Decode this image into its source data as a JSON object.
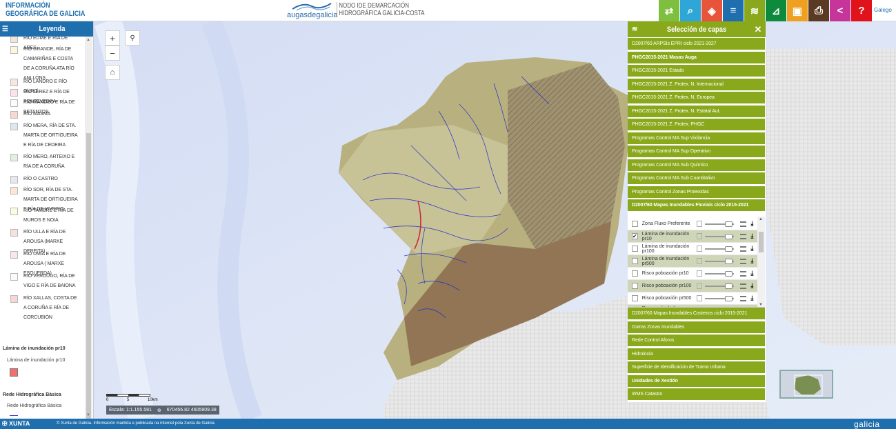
{
  "header": {
    "brand_line1": "INFORMACIÓN",
    "brand_line2": "GEOGRÁFICA DE GALICIA",
    "logo_text": "augasdegalicia",
    "node_line1": "NODO IDE DEMARCACIÓN",
    "node_line2": "HIDROGRÁFICA GALICIA-COSTA",
    "language": "Galego",
    "tools": [
      {
        "icon": "link-icon",
        "glyph": "⇄",
        "color": "#7fbf3f"
      },
      {
        "icon": "search-icon",
        "glyph": "⌕",
        "color": "#2fa6d8"
      },
      {
        "icon": "map-tool-icon",
        "glyph": "◈",
        "color": "#e8543a"
      },
      {
        "icon": "list-icon",
        "glyph": "≡",
        "color": "#1f6fae"
      },
      {
        "icon": "layers-icon",
        "glyph": "≋",
        "color": "#8aa81b"
      },
      {
        "icon": "measure-icon",
        "glyph": "⊿",
        "color": "#0e8a3c"
      },
      {
        "icon": "save-icon",
        "glyph": "▣",
        "color": "#f0a020"
      },
      {
        "icon": "print-icon",
        "glyph": "⎙",
        "color": "#5a3a22"
      },
      {
        "icon": "share-icon",
        "glyph": "<",
        "color": "#c7359a"
      },
      {
        "icon": "help-icon",
        "glyph": "?",
        "color": "#e0131b"
      }
    ]
  },
  "legend": {
    "title": "Leyenda",
    "items": [
      {
        "label": "RÍO EUME E RÍA DE ARES",
        "color": "#f3e3d8"
      },
      {
        "label": "RÍO GRANDE, RÍA DE CAMARIÑAS E COSTA DE A CORUÑA ATA RÍO ANLLÓNS",
        "color": "#fbf7d9"
      },
      {
        "label": "RÍO LANDRO E RÍO OURO",
        "color": "#f6e8e0"
      },
      {
        "label": "RÍO LÉREZ E RÍA DE PONTEVEDRA",
        "color": "#fbe3e8"
      },
      {
        "label": "RÍO MANDEO E RÍA DE BETANZOS",
        "color": "#fbfbfb"
      },
      {
        "label": "RÍO MASMA",
        "color": "#f7d9d2"
      },
      {
        "label": "RÍO MERA, RÍA DE STA. MARTA DE ORTIGUEIRA E RÍA DE CEDEIRA",
        "color": "#dee7f0"
      },
      {
        "label": "RÍO MERO, ARTEIXO E RÍA DE A CORUÑA",
        "color": "#e2f1de"
      },
      {
        "label": "RÍO O CASTRO",
        "color": "#e8e8ee"
      },
      {
        "label": "RÍO SOR, RÍA DE STA. MARTA DE ORTIGUEIRA E RÍA DE VIVEIRO",
        "color": "#fbe7d2"
      },
      {
        "label": "RÍO TAMBRE E RÍA DE MUROS E NOIA",
        "color": "#fbfbe2"
      },
      {
        "label": "RÍO ULLA E RÍA DE AROUSA (MARXE DEREITA)",
        "color": "#f6e2db"
      },
      {
        "label": "RÍO UMIA E RÍA DE AROUSA ( MARXE ESQUERDA)",
        "color": "#f8e6ea"
      },
      {
        "label": "RÍO VERDUGO, RÍA DE VIGO E RÍA DE BAIONA",
        "color": "#fbfbfb"
      },
      {
        "label": "RÍO XALLAS, COSTA DE A CORUÑA E RÍA DE CORCUBIÓN",
        "color": "#f7d6d6"
      }
    ],
    "section_inundation": "Lámina de inundación pr10",
    "sub_inundation": "Lámina de inundación pr10",
    "inundation_color": "#f07070",
    "section_network": "Rede Hidrográfica Básica",
    "sub_network": "Rede Hidrográfica Básica",
    "network_color": "#3a3ad0"
  },
  "map": {
    "scale_ticks": [
      "0",
      "5",
      "10km"
    ],
    "scale_text": "Escala: 1:1.155.581",
    "coords": "670456.82  4605909.38"
  },
  "layers_panel": {
    "title": "Selección de capas",
    "groups_top": [
      {
        "label": "D2007/60 ARPSIs EPRI ciclo 2021-2027",
        "bold": false
      },
      {
        "label": "PHGC2015-2021 Masas Auga",
        "bold": true
      },
      {
        "label": "PHGC2015-2021 Estado",
        "bold": false
      },
      {
        "label": "PHGC2015-2021 Z. Protex. N. Internacional",
        "bold": false
      },
      {
        "label": "PHGC2015-2021 Z. Protex. N. Europea",
        "bold": false
      },
      {
        "label": "PHGC2015-2021 Z. Protex. N. Estatal Aut.",
        "bold": false
      },
      {
        "label": "PHGC2015-2021 Z. Protex. PHGC",
        "bold": false
      },
      {
        "label": "Programas Control MA Sup Vixilancia",
        "bold": false
      },
      {
        "label": "Programas Control MA Sup Operativo",
        "bold": false
      },
      {
        "label": "Programas Control MA Sub Químico",
        "bold": false
      },
      {
        "label": "Programas Control MA Sub Cuantitativo",
        "bold": false
      },
      {
        "label": "Programas Control Zonas Protexidas",
        "bold": false
      },
      {
        "label": "D2007/60 Mapas Inundables Fluviais ciclo 2015-2021",
        "bold": true
      }
    ],
    "sublayers": [
      {
        "label": "Zona Fluxo Preferente",
        "checked": "",
        "alt": false
      },
      {
        "label": "Lámina de inundación pr10",
        "checked": "✔",
        "alt": true
      },
      {
        "label": "Lámina de inundación pr100",
        "checked": "",
        "alt": false
      },
      {
        "label": "Lámina de inundación pr500",
        "checked": "",
        "alt": true
      },
      {
        "label": "Risco poboación pr10",
        "checked": "",
        "alt": false
      },
      {
        "label": "Risco poboación pr100",
        "checked": "",
        "alt": true
      },
      {
        "label": "Risco poboación pr500",
        "checked": "",
        "alt": false
      },
      {
        "label": "Risco actividade económica",
        "checked": "",
        "alt": true
      }
    ],
    "groups_bottom": [
      {
        "label": "D2007/60 Mapas Inundables Costeiros ciclo 2015-2021",
        "bold": false
      },
      {
        "label": "Outras Zonas Inundables",
        "bold": false
      },
      {
        "label": "Rede Control Aforos",
        "bold": false
      },
      {
        "label": "Hidroloxía",
        "bold": false
      },
      {
        "label": "Superficie de Identificación de Trama Urbana",
        "bold": false
      },
      {
        "label": "Unidades de Xestión",
        "bold": true
      },
      {
        "label": "WMS Catastro",
        "bold": false
      }
    ]
  },
  "footer": {
    "xunta": "XUNTA",
    "copyright": "© Xunta de Galicia. Información mantida e publicada na internet pola Xunta de Galicia",
    "galicia": "galicia"
  }
}
